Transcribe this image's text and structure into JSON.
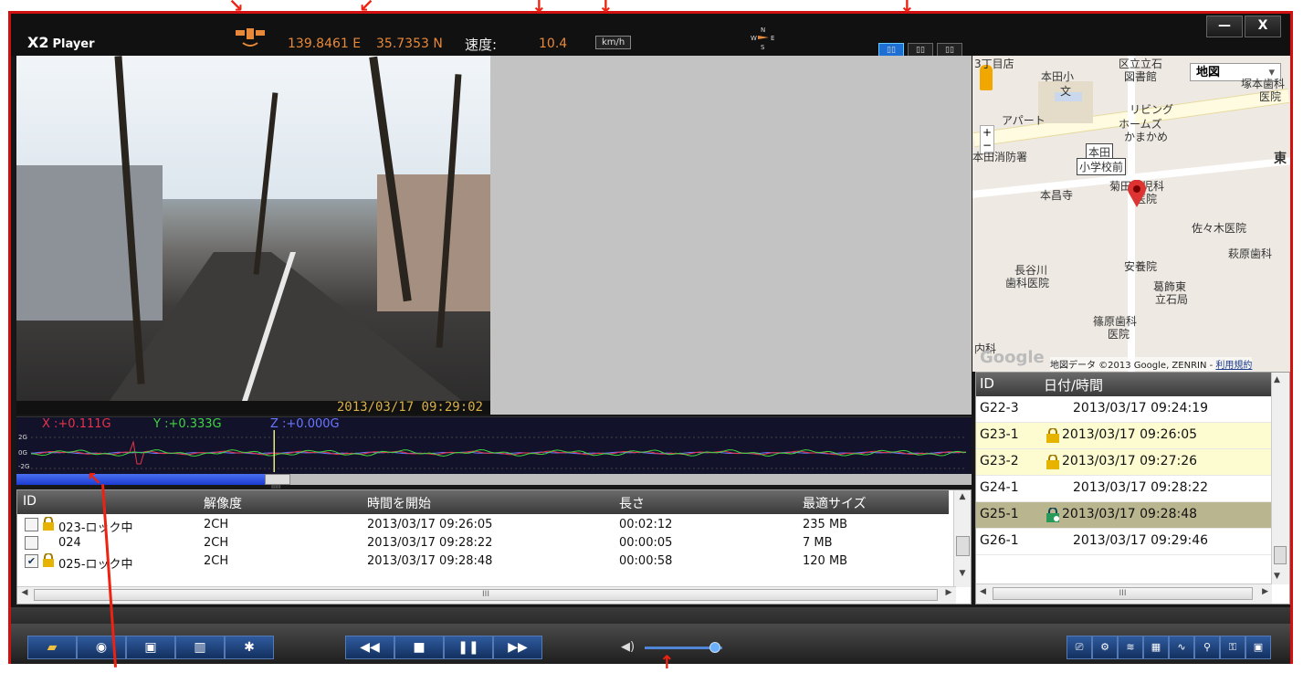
{
  "app": {
    "name": "X2",
    "name_suffix": "Player"
  },
  "gps": {
    "longitude": "139.8461 E",
    "latitude": "35.7353 N",
    "speed_label": "速度:",
    "speed_value": "10.4",
    "speed_unit": "km/h"
  },
  "compass": {
    "n": "N",
    "e": "E",
    "s": "S",
    "w": "W"
  },
  "layout_buttons": [
    "▯▯",
    "▯▯",
    "▯▯"
  ],
  "window_controls": {
    "minimize": "—",
    "close": "X"
  },
  "video": {
    "timestamp": "2013/03/17   09:29:02"
  },
  "gsensor": {
    "x_label": "X :+0.111G",
    "y_label": "Y :+0.333G",
    "z_label": "Z :+0.000G",
    "axis_top": "2G",
    "axis_mid": "0G",
    "axis_bot": "-2G",
    "x_color": "#e8334a",
    "y_color": "#3fd53f",
    "z_color": "#6a77ff",
    "playhead_fraction": 0.26
  },
  "playback_progress": {
    "fraction": 0.26,
    "thumb_label": "IIIII"
  },
  "map": {
    "type_select": "地図",
    "labels": [
      "3丁目店",
      "本田小",
      "文",
      "区立立石",
      "図書館",
      "塚本歯科",
      "医院",
      "リビング",
      "ホームズ",
      "かまかめ",
      "アパート",
      "本田消防署",
      "本田",
      "小学校前",
      "東",
      "本昌寺",
      "菊田小児科",
      "医院",
      "佐々木医院",
      "長谷川",
      "歯科医院",
      "安養院",
      "萩原歯科",
      "葛飾東",
      "立石局",
      "篠原歯科",
      "医院",
      "内科"
    ],
    "attribution": "地図データ ©2013 Google, ZENRIN - ",
    "terms_link": "利用規約",
    "google": "Google"
  },
  "file_table": {
    "headers": [
      "ID",
      "解像度",
      "時間を開始",
      "長さ",
      "最適サイズ"
    ],
    "rows": [
      {
        "checked": false,
        "locked": true,
        "id": "023-ロック中",
        "res": "2CH",
        "start": "2013/03/17 09:26:05",
        "length": "00:02:12",
        "size": "235 MB"
      },
      {
        "checked": false,
        "locked": false,
        "id": "024",
        "res": "2CH",
        "start": "2013/03/17 09:28:22",
        "length": "00:00:05",
        "size": "7 MB"
      },
      {
        "checked": true,
        "locked": true,
        "id": "025-ロック中",
        "res": "2CH",
        "start": "2013/03/17 09:28:48",
        "length": "00:00:58",
        "size": "120 MB"
      }
    ],
    "hscroll_label": "III"
  },
  "event_list": {
    "headers": [
      "ID",
      "日付/時間"
    ],
    "rows": [
      {
        "id": "G22-3",
        "datetime": "2013/03/17 09:24:19",
        "icon": "",
        "state": ""
      },
      {
        "id": "G23-1",
        "datetime": "2013/03/17 09:26:05",
        "icon": "lock-icon",
        "state": "highlight"
      },
      {
        "id": "G23-2",
        "datetime": "2013/03/17 09:27:26",
        "icon": "lock-icon",
        "state": "highlight"
      },
      {
        "id": "G24-1",
        "datetime": "2013/03/17 09:28:22",
        "icon": "",
        "state": ""
      },
      {
        "id": "G25-1",
        "datetime": "2013/03/17 09:28:48",
        "icon": "lock-info-icon",
        "state": "selected"
      },
      {
        "id": "G26-1",
        "datetime": "2013/03/17 09:29:46",
        "icon": "",
        "state": ""
      }
    ],
    "hscroll_label": "III"
  },
  "toolbar": {
    "left_buttons": [
      "open-folder-icon",
      "camera-icon",
      "save-icon",
      "trash-icon",
      "settings-icon"
    ],
    "left_glyphs": [
      "▰",
      "◉",
      "▣",
      "▥",
      "✱"
    ],
    "transport_glyphs": [
      "◀◀",
      "■",
      "❚❚",
      "▶▶"
    ],
    "volume_fraction": 0.9,
    "volume_glyph": "◀)",
    "right_glyphs": [
      "⎚",
      "⚙",
      "≋",
      "▦",
      "∿",
      "⚲",
      "⚿",
      "▣"
    ]
  },
  "colors": {
    "accent_orange": "#e8893a",
    "frame_red": "#d21010",
    "button_blue": "#2f5b9e"
  }
}
